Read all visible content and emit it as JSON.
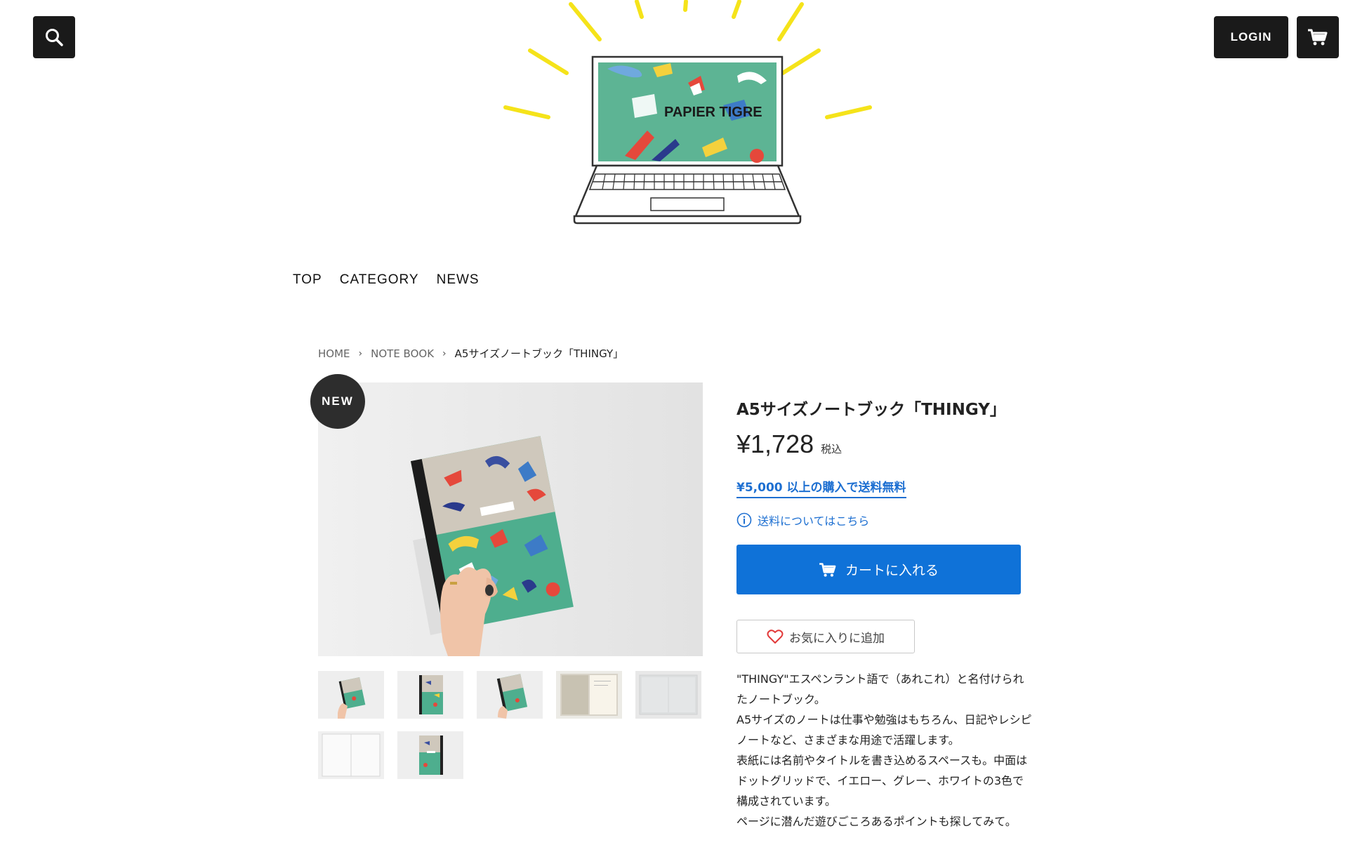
{
  "header": {
    "login_label": "LOGIN",
    "search_icon": "search-icon",
    "cart_icon": "cart-icon"
  },
  "logo": {
    "brand": "PAPIER TIGRE",
    "accent_color": "#f5e31a",
    "screen_color": "#5db494"
  },
  "nav": {
    "items": [
      "TOP",
      "CATEGORY",
      "NEWS"
    ]
  },
  "breadcrumb": {
    "home": "HOME",
    "category": "NOTE BOOK",
    "current": "A5サイズノートブック「THINGY」"
  },
  "product": {
    "badge": "NEW",
    "title": "A5サイズノートブック「THINGY」",
    "price": "¥1,728",
    "tax_label": "税込",
    "free_shipping": "¥5,000 以上の購入で送料無料",
    "shipping_info": "送料についてはこちら",
    "add_to_cart": "カートに入れる",
    "favorite": "お気に入りに追加",
    "description_lines": [
      "\"THINGY\"エスペンラント語で（あれこれ）と名付けられ",
      "たノートブック。",
      "A5サイズのノートは仕事や勉強はもちろん、日記やレシピ",
      "ノートなど、さまざまな用途で活躍します。",
      "表紙には名前やタイトルを書き込めるスペースも。中面は",
      "ドットグリッドで、イエロー、グレー、ホワイトの3色で",
      "構成されています。",
      "ページに潜んだ遊びごころあるポイントも探してみて。"
    ],
    "thumbnail_count": 7
  },
  "colors": {
    "primary_button": "#0f72d8",
    "link": "#1d6fd1",
    "dark_button": "#1a1a1a",
    "cover_green": "#4eae8e",
    "cover_beige": "#cfc8bc"
  }
}
